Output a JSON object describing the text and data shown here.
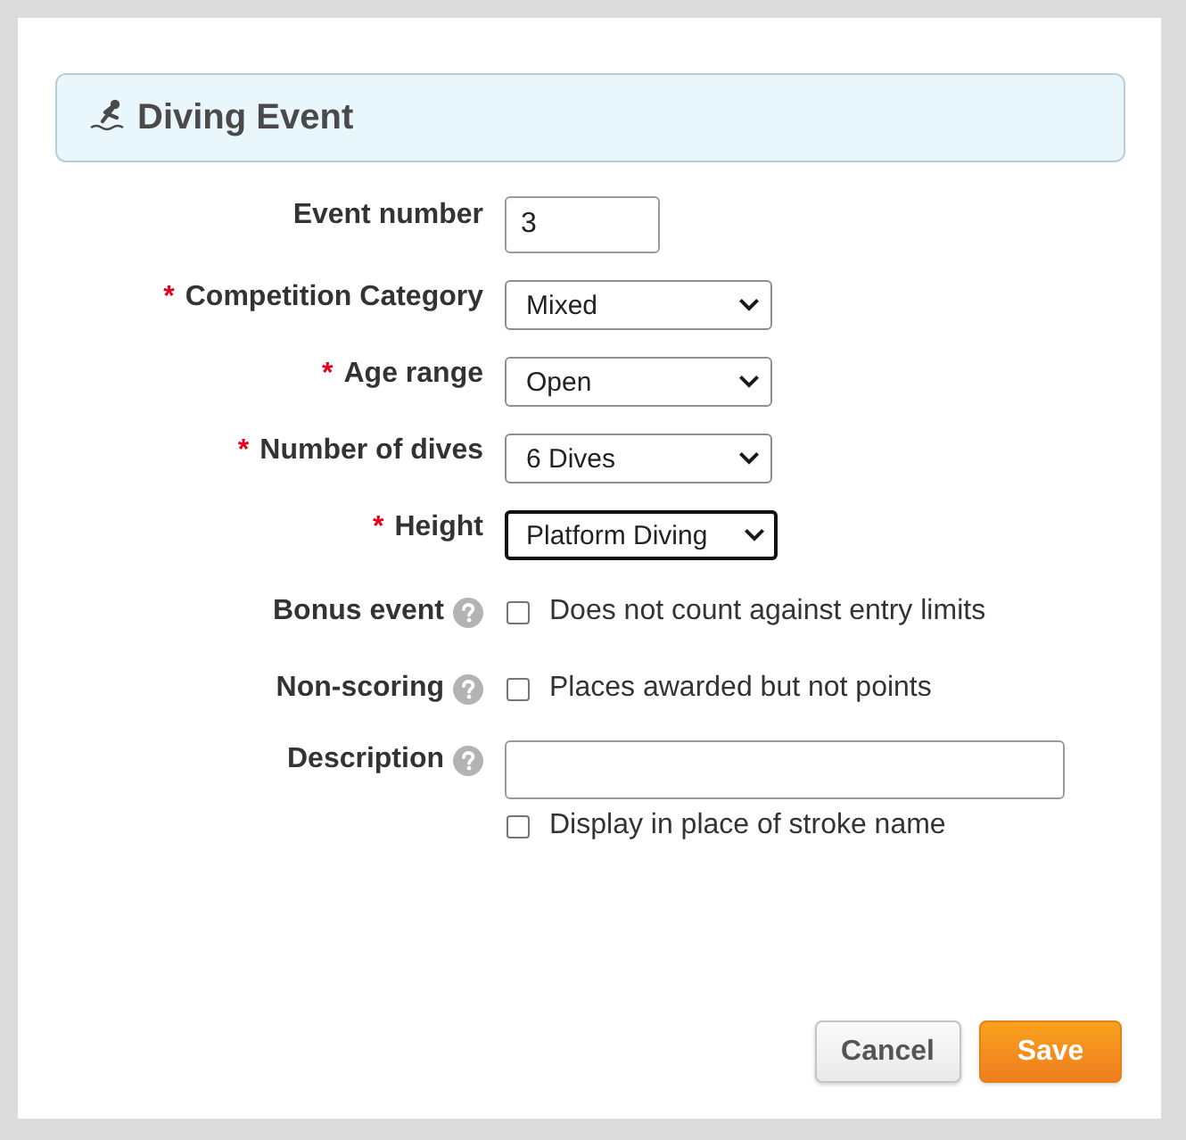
{
  "dialog": {
    "title": "Diving Event"
  },
  "fields": [
    {
      "kind": "number",
      "label": "Event number",
      "help": false,
      "value": "3"
    },
    {
      "kind": "select",
      "label": "Competition Category",
      "required_marker": "*",
      "help": false,
      "value": "Mixed",
      "focused": false
    },
    {
      "kind": "select",
      "label": "Age range",
      "required_marker": "*",
      "help": false,
      "value": "Open",
      "focused": false
    },
    {
      "kind": "select",
      "label": "Number of dives",
      "required_marker": "*",
      "help": false,
      "value": "6 Dives",
      "focused": false
    },
    {
      "kind": "select",
      "label": "Height",
      "required_marker": "*",
      "help": false,
      "value": "Platform Diving",
      "focused": true
    },
    {
      "kind": "checkbox",
      "label": "Bonus event",
      "help": true,
      "checked": false,
      "text": "Does not count against entry limits"
    },
    {
      "kind": "checkbox",
      "label": "Non-scoring",
      "help": true,
      "checked": false,
      "text": "Places awarded but not points"
    },
    {
      "kind": "text",
      "label": "Description",
      "help": true,
      "option": {
        "checked": false,
        "text": "Display in place of stroke name"
      }
    }
  ],
  "buttons": [
    {
      "label": "Cancel",
      "kind": "secondary"
    },
    {
      "label": "Save",
      "kind": "primary"
    }
  ]
}
